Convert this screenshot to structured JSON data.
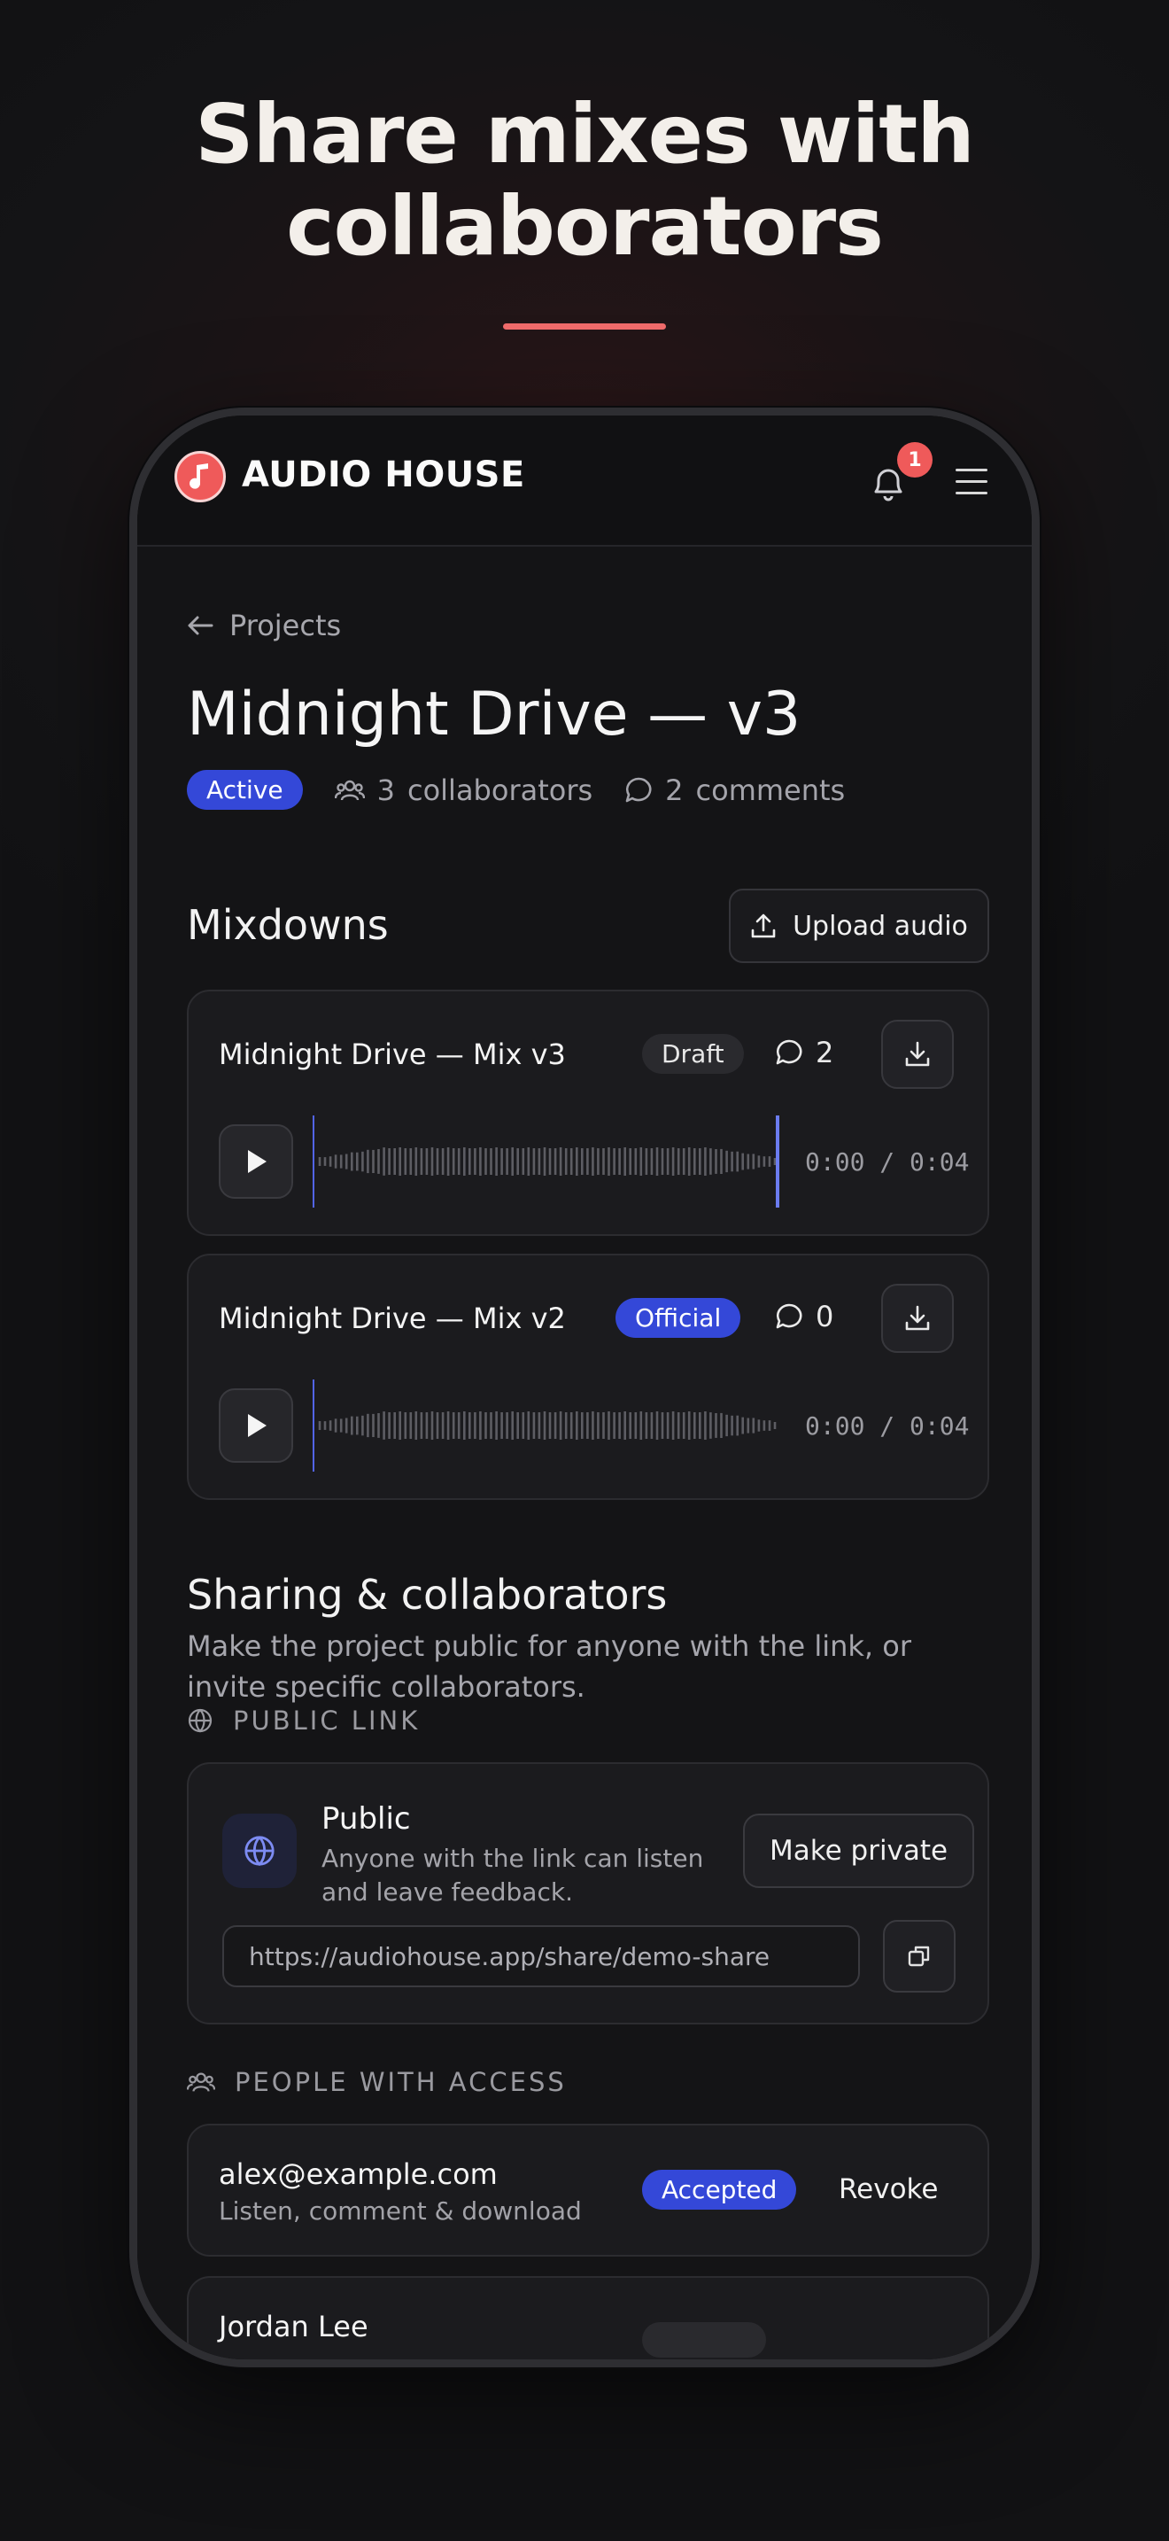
{
  "hero": {
    "line1": "Share mixes with",
    "line2": "collaborators"
  },
  "app": {
    "brand": "AUDIO HOUSE",
    "notification_count": "1"
  },
  "breadcrumb": {
    "back_label": "Projects"
  },
  "project": {
    "title": "Midnight Drive — v3",
    "status": "Active",
    "collaborators_count": "3",
    "collaborators_label": "collaborators",
    "comments_count": "2",
    "comments_label": "comments"
  },
  "mixdowns": {
    "heading": "Mixdowns",
    "upload_label": "Upload audio",
    "items": [
      {
        "title": "Midnight Drive — Mix v3",
        "status": "Draft",
        "comments": "2",
        "time": "0:00 / 0:04",
        "progress": 1.0
      },
      {
        "title": "Midnight Drive — Mix v2",
        "status": "Official",
        "comments": "0",
        "time": "0:00 / 0:04",
        "progress": 0.0
      }
    ]
  },
  "sharing": {
    "heading": "Sharing & collaborators",
    "description": "Make the project public for anyone with the link, or invite specific collaborators.",
    "public_link_label": "PUBLIC LINK",
    "public_title": "Public",
    "public_desc": "Anyone with the link can listen and leave feedback.",
    "make_private_label": "Make private",
    "share_url": "https://audiohouse.app/share/demo-share",
    "people_label": "PEOPLE WITH ACCESS",
    "people": [
      {
        "email": "alex@example.com",
        "role": "Listen, comment & download",
        "status": "Accepted",
        "action": "Revoke"
      },
      {
        "email": "Jordan Lee",
        "role": "",
        "status": "",
        "action": ""
      }
    ]
  },
  "colors": {
    "accent_red": "#ef5a5a",
    "accent_blue": "#3448d8",
    "background": "#141416"
  }
}
